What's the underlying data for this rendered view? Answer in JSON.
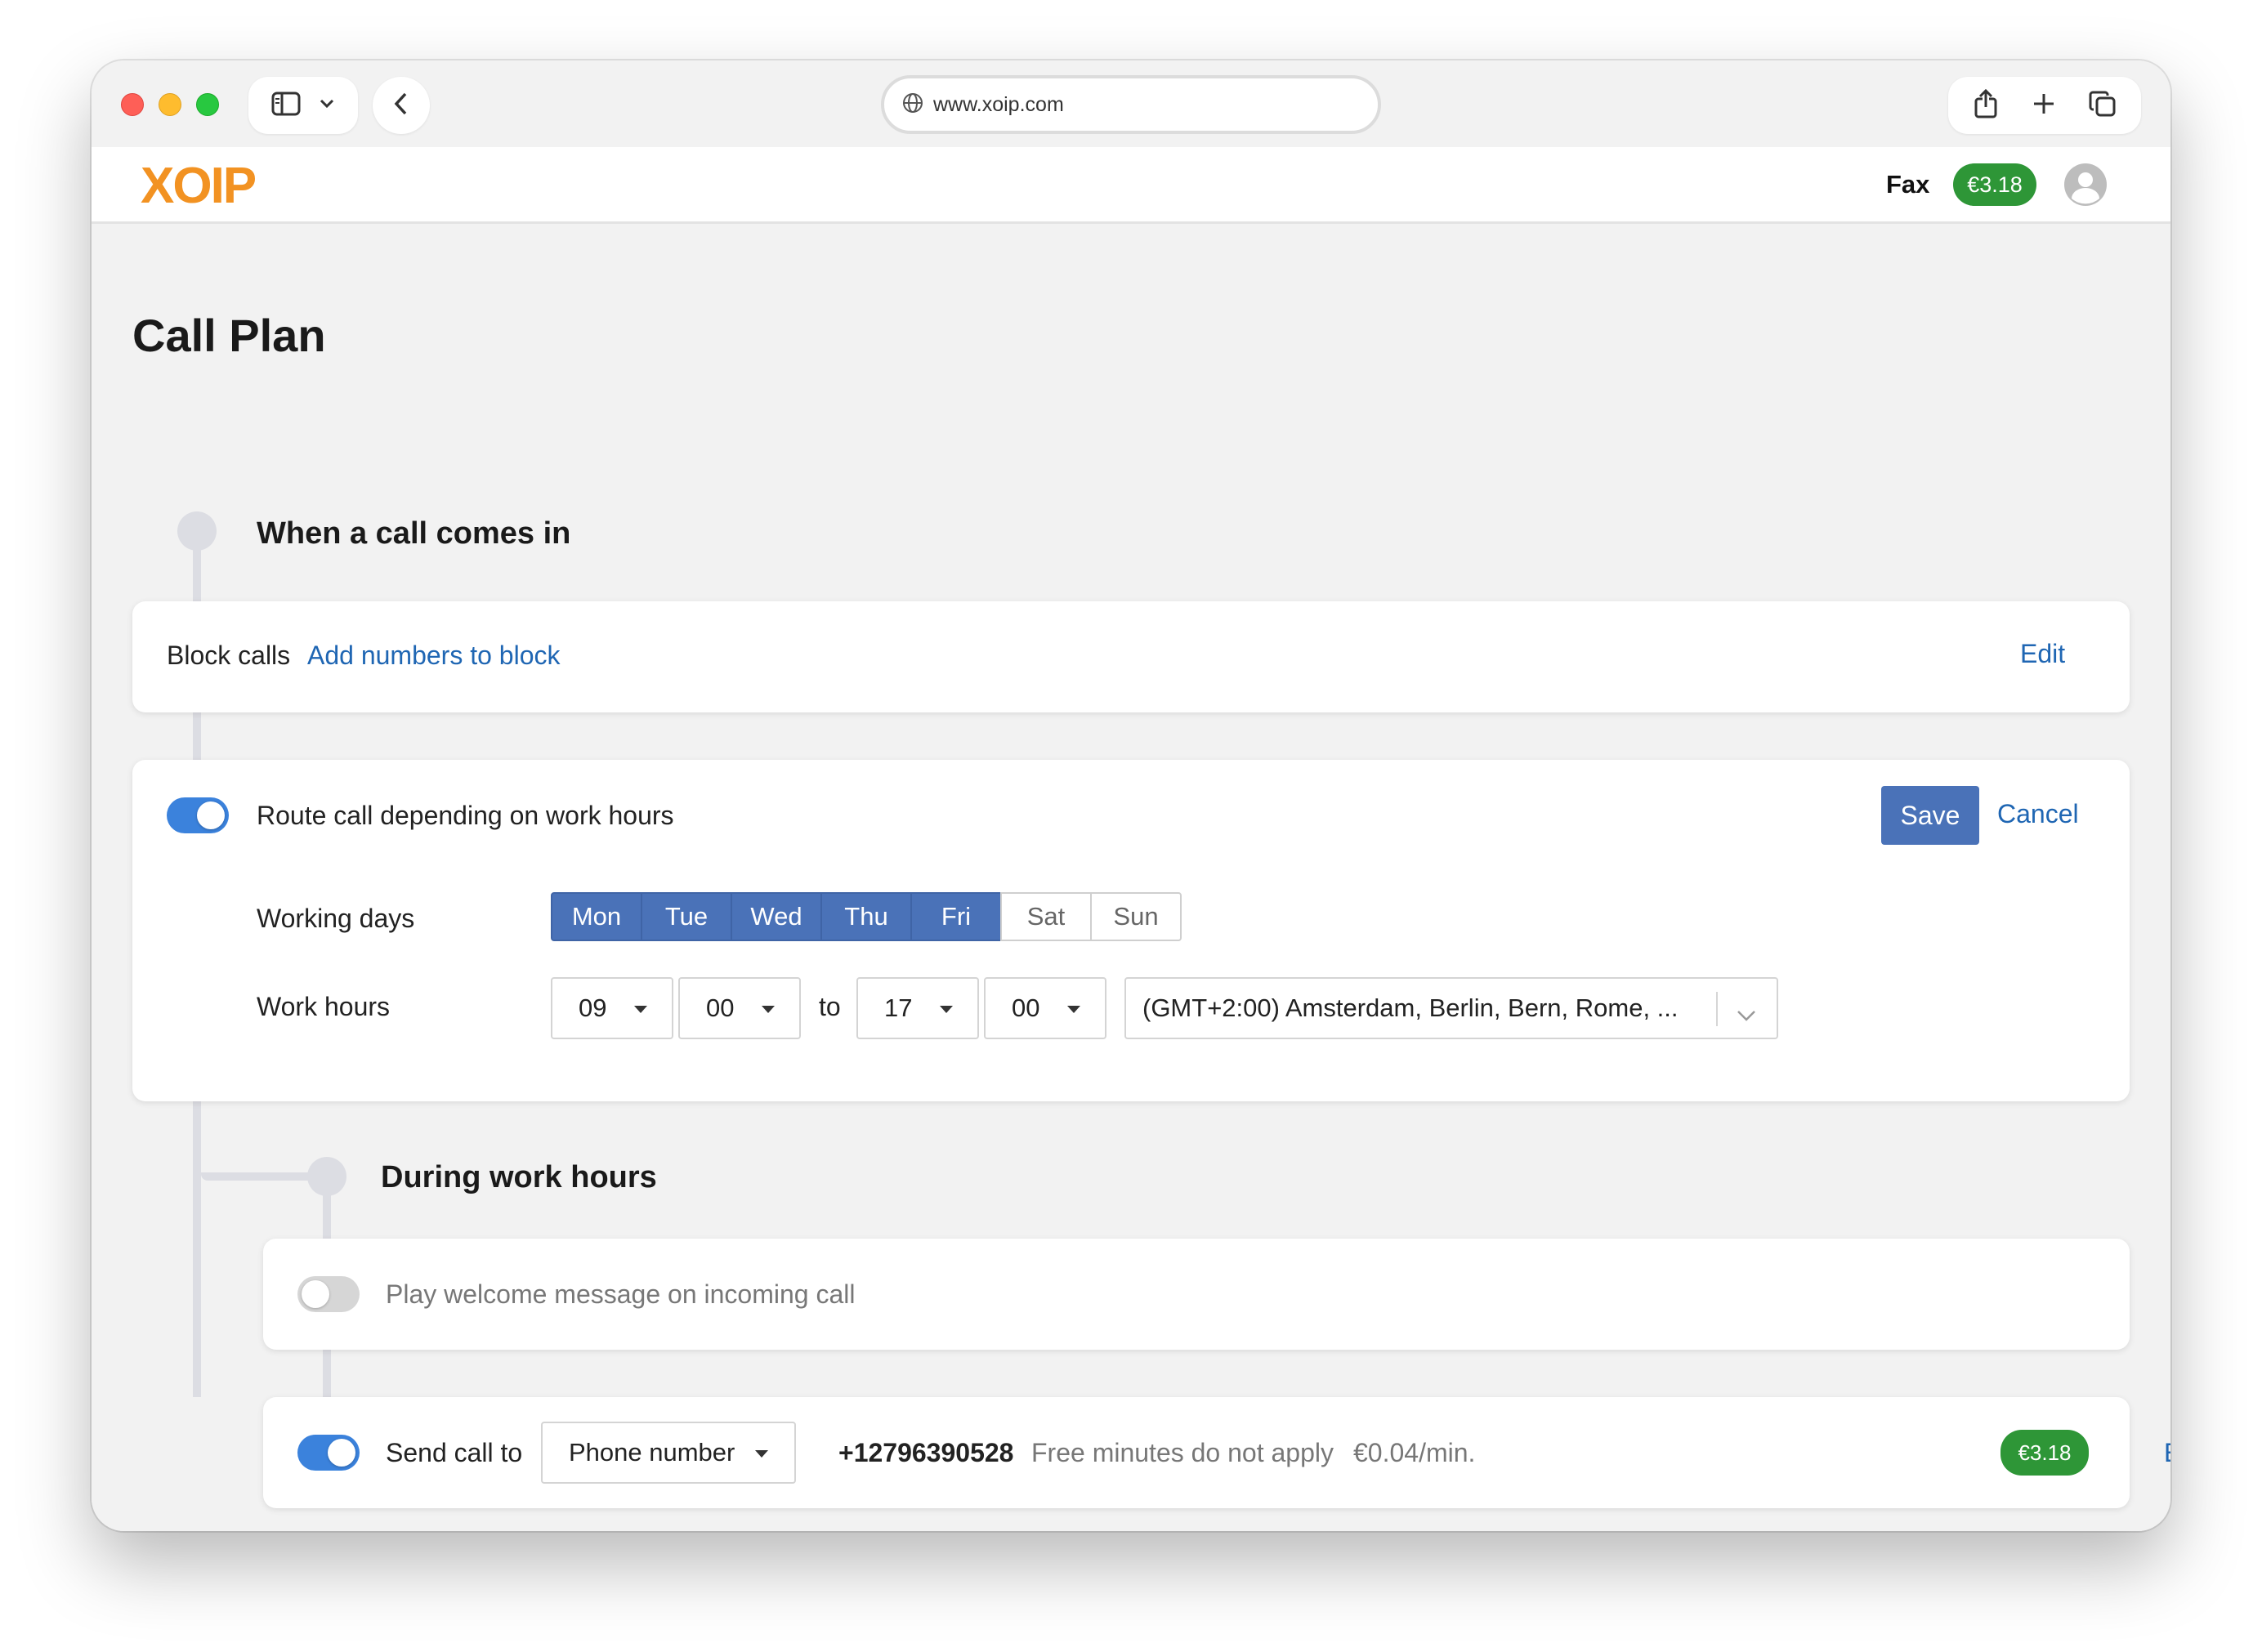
{
  "browser": {
    "url": "www.xoip.com"
  },
  "header": {
    "logo": "XOIP",
    "fax_label": "Fax",
    "balance": "€3.18"
  },
  "page": {
    "title": "Call Plan"
  },
  "incoming": {
    "title": "When a call comes in",
    "block_label": "Block calls",
    "block_link": "Add numbers to block",
    "block_edit": "Edit"
  },
  "work_hours": {
    "route_label": "Route call depending on work hours",
    "route_enabled": true,
    "save_label": "Save",
    "cancel_label": "Cancel",
    "days_label": "Working days",
    "days": [
      {
        "label": "Mon",
        "selected": true
      },
      {
        "label": "Tue",
        "selected": true
      },
      {
        "label": "Wed",
        "selected": true
      },
      {
        "label": "Thu",
        "selected": true
      },
      {
        "label": "Fri",
        "selected": true
      },
      {
        "label": "Sat",
        "selected": false
      },
      {
        "label": "Sun",
        "selected": false
      }
    ],
    "hours_label": "Work hours",
    "start_hour": "09",
    "start_minute": "00",
    "to_label": "to",
    "end_hour": "17",
    "end_minute": "00",
    "timezone": "(GMT+2:00) Amsterdam, Berlin, Bern, Rome, ..."
  },
  "during": {
    "title": "During work hours",
    "welcome_label": "Play welcome message on incoming call",
    "welcome_enabled": false,
    "send_label": "Send call to",
    "send_enabled": true,
    "send_type": "Phone number",
    "phone": "+12796390528",
    "free_note": "Free minutes do not apply",
    "rate": "€0.04/min.",
    "balance": "€3.18",
    "edit_label": "Edit"
  },
  "colors": {
    "accent": "#4a72b8",
    "toggle_on": "#3b82dc",
    "link": "#1f66b3",
    "badge": "#2e9637",
    "logo": "#f29222"
  }
}
